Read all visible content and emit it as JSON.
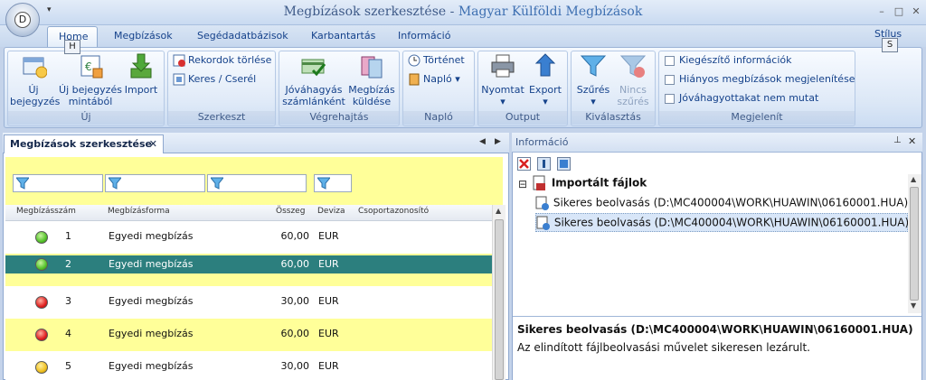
{
  "titlebar": {
    "doc_title": "Megbízások szerkesztése",
    "separator": " - ",
    "app_title": "Magyar Külföldi Megbízások",
    "qat_symbol": "▾",
    "app_button_letter": "D",
    "minimize": "–",
    "maximize": "□",
    "close": "✕"
  },
  "tabs": [
    {
      "label": "Home",
      "active": true
    },
    {
      "label": "Megbízások"
    },
    {
      "label": "Segédadatbázisok"
    },
    {
      "label": "Karbantartás"
    },
    {
      "label": "Információ"
    }
  ],
  "stilus_label": "Stílus",
  "keytips": {
    "home": "H",
    "stilus": "S"
  },
  "ribbon": {
    "groups": {
      "uj": "Új",
      "szerkeszt": "Szerkeszt",
      "vegrehajtas": "Végrehajtás",
      "naplo": "Napló",
      "output": "Output",
      "kivalasztas": "Kiválasztás",
      "megjelenit": "Megjelenít"
    },
    "uj_bejegyzes": [
      "Új",
      "bejegyzés"
    ],
    "uj_mintabol": [
      "Új bejegyzés",
      "mintából"
    ],
    "import": "Import",
    "rekordok_torlese": "Rekordok törlése",
    "keres_csere": "Keres / Cserél",
    "jovahagyas": [
      "Jóváhagyás",
      "számlánként"
    ],
    "megbizas_kuldese": [
      "Megbízás",
      "küldése"
    ],
    "tortenet": "Történet",
    "naplo_btn": "Napló",
    "nyomtat": "Nyomtat",
    "export": "Export",
    "szures": "Szűrés",
    "nincs_szures": [
      "Nincs",
      "szűrés"
    ],
    "kiegeszito": "Kiegészítő információk",
    "hianyos": "Hiányos megbízások megjelenítése",
    "jovahagyottakat": "Jóváhagyottakat nem mutat",
    "dropdown_marker": "▾"
  },
  "left_panel": {
    "tab_title": "Megbízások szerkesztése",
    "tab_close": "✕",
    "nav_prev": "◀",
    "nav_next": "▶",
    "columns": [
      "Megbízásszám",
      "Megbízásforma",
      "Összeg",
      "Deviza",
      "Csoportazonosító"
    ],
    "rows": [
      {
        "status": "green",
        "number": "1",
        "form": "Egyedi megbízás",
        "amount": "60,00",
        "currency": "EUR",
        "group": ""
      },
      {
        "status": "green",
        "number": "2",
        "form": "Egyedi megbízás",
        "amount": "60,00",
        "currency": "EUR",
        "group": "",
        "selected": true
      },
      {
        "status": "red",
        "number": "3",
        "form": "Egyedi megbízás",
        "amount": "30,00",
        "currency": "EUR",
        "group": ""
      },
      {
        "status": "red",
        "number": "4",
        "form": "Egyedi megbízás",
        "amount": "60,00",
        "currency": "EUR",
        "group": ""
      },
      {
        "status": "yellow",
        "number": "5",
        "form": "Egyedi megbízás",
        "amount": "30,00",
        "currency": "EUR",
        "group": ""
      }
    ]
  },
  "right_panel": {
    "title": "Információ",
    "pin": "⊥",
    "close": "✕",
    "tree": {
      "toggle": "⊟",
      "root": "Importált fájlok",
      "children": [
        "Sikeres beolvasás (D:\\MC400004\\WORK\\HUAWIN\\06160001.HUA)",
        "Sikeres beolvasás (D:\\MC400004\\WORK\\HUAWIN\\06160001.HUA)"
      ]
    },
    "detail_title": "Sikeres beolvasás (D:\\MC400004\\WORK\\HUAWIN\\06160001.HUA)",
    "detail_text": "Az elindított fájlbeolvasási művelet sikeresen lezárult."
  },
  "colors": {
    "accent": "#15428b",
    "selected_row": "#2c7f7e",
    "yellow_row": "#ffff99",
    "status_green": "#54c22a",
    "status_red": "#e02020",
    "status_yellow": "#f0c020"
  }
}
